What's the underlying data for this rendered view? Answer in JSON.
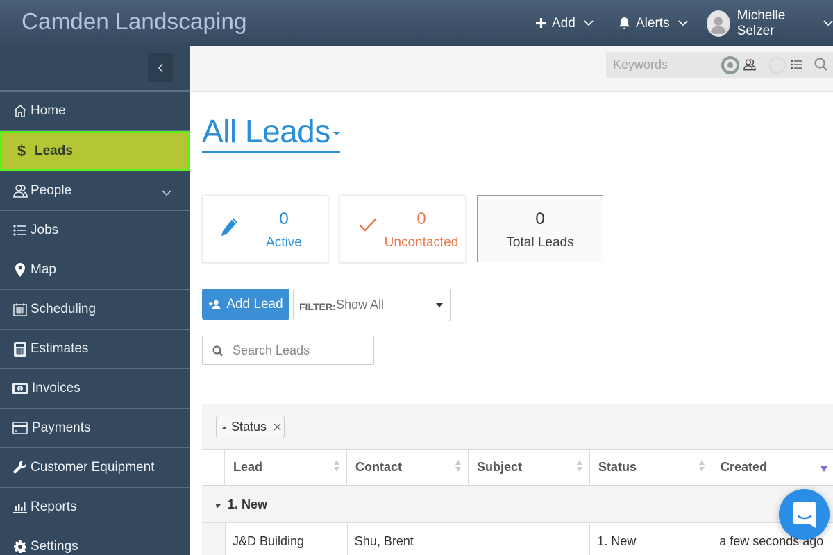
{
  "app": {
    "brand": "Camden Landscaping"
  },
  "topbar": {
    "add_label": "Add",
    "alerts_label": "Alerts",
    "user_name": "Michelle Selzer"
  },
  "sidebar": {
    "items": [
      {
        "label": "Home",
        "icon": "home-icon"
      },
      {
        "label": "Leads",
        "icon": "dollar-icon",
        "active": true
      },
      {
        "label": "People",
        "icon": "people-icon",
        "has_submenu": true
      },
      {
        "label": "Jobs",
        "icon": "list-icon"
      },
      {
        "label": "Map",
        "icon": "map-pin-icon"
      },
      {
        "label": "Scheduling",
        "icon": "calendar-icon"
      },
      {
        "label": "Estimates",
        "icon": "calculator-icon"
      },
      {
        "label": "Invoices",
        "icon": "money-icon"
      },
      {
        "label": "Payments",
        "icon": "credit-card-icon"
      },
      {
        "label": "Customer Equipment",
        "icon": "wrench-icon"
      },
      {
        "label": "Reports",
        "icon": "bar-chart-icon"
      },
      {
        "label": "Settings",
        "icon": "gear-icon"
      }
    ]
  },
  "keyword_search": {
    "placeholder": "Keywords"
  },
  "page": {
    "title": "All Leads"
  },
  "stats": {
    "active": {
      "value": "0",
      "label": "Active",
      "color": "#2a8ed8"
    },
    "uncontacted": {
      "value": "0",
      "label": "Uncontacted",
      "color": "#ee7a4c"
    },
    "total": {
      "value": "0",
      "label": "Total Leads",
      "color": "#333333"
    }
  },
  "toolbar": {
    "add_lead_label": "Add Lead",
    "filter_label": "FILTER:",
    "filter_value": "Show All",
    "search_placeholder": "Search Leads"
  },
  "grid": {
    "group_chip": "Status",
    "columns": [
      "Lead",
      "Contact",
      "Subject",
      "Status",
      "Created"
    ],
    "groups": [
      {
        "label": "1. New",
        "rows": [
          {
            "lead": "J&D Building",
            "contact": "Shu, Brent",
            "subject": "",
            "status": "1. New",
            "created": "a few seconds ago"
          }
        ]
      }
    ]
  },
  "colors": {
    "accent": "#2a8ed8",
    "active_nav": "#b5c634",
    "active_nav_border": "#59f21a",
    "sidebar": "#34495e"
  }
}
